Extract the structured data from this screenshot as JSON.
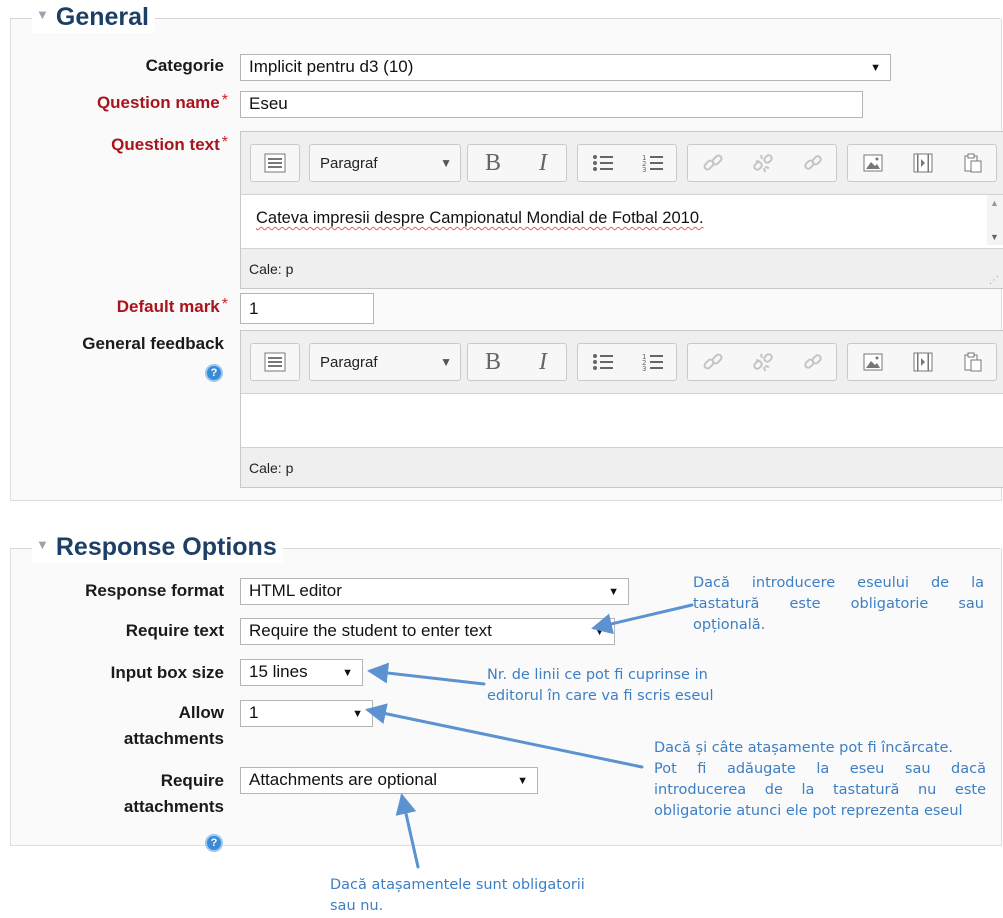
{
  "general": {
    "legend": "General",
    "categorie_label": "Categorie",
    "categorie_value": "Implicit pentru d3 (10)",
    "question_name_label": "Question name",
    "question_name_value": "Eseu",
    "question_text_label": "Question text",
    "question_text_value": "Cateva impresii despre Campionatul Mondial de Fotbal 2010.",
    "default_mark_label": "Default mark",
    "default_mark_value": "1",
    "general_feedback_label": "General feedback",
    "required_star": "*"
  },
  "editor": {
    "paragraph_label": "Paragraf",
    "status_text": "Cale: p",
    "icons": [
      "toolbar-toggle-icon",
      "bold-icon",
      "italic-icon",
      "unordered-list-icon",
      "ordered-list-icon",
      "link-icon",
      "unlink-icon",
      "anchor-icon",
      "image-icon",
      "media-icon",
      "paste-icon"
    ]
  },
  "response": {
    "legend": "Response Options",
    "response_format_label": "Response format",
    "response_format_value": "HTML editor",
    "require_text_label": "Require text",
    "require_text_value": "Require the student to enter text",
    "input_box_size_label": "Input box size",
    "input_box_size_value": "15 lines",
    "allow_attachments_label_1": "Allow",
    "allow_attachments_label_2": "attachments",
    "allow_attachments_value": "1",
    "require_attachments_label_1": "Require",
    "require_attachments_label_2": "attachments",
    "require_attachments_value": "Attachments are optional"
  },
  "annotations": {
    "require_text_note_1": "Dacă introducere eseului de la",
    "require_text_note_2": "tastatură este obligatorie sau",
    "require_text_note_3": "opțională.",
    "input_box_note_1": "Nr. de linii ce pot fi cuprinse in",
    "input_box_note_2": "editorul în care va fi scris eseul",
    "attachments_note_1": "Dacă și câte atașamente pot fi încărcate.",
    "attachments_note_2": "Pot fi adăugate la eseu sau dacă",
    "attachments_note_3": "introducerea de la tastatură nu este",
    "attachments_note_4": "obligatorie atunci ele pot reprezenta eseul",
    "require_attachments_note_1": "Dacă atașamentele sunt obligatorii",
    "require_attachments_note_2": "sau nu."
  },
  "colors": {
    "legend": "#1d3f66",
    "required_label": "#a8141c",
    "annotation": "#3d7fc4"
  }
}
